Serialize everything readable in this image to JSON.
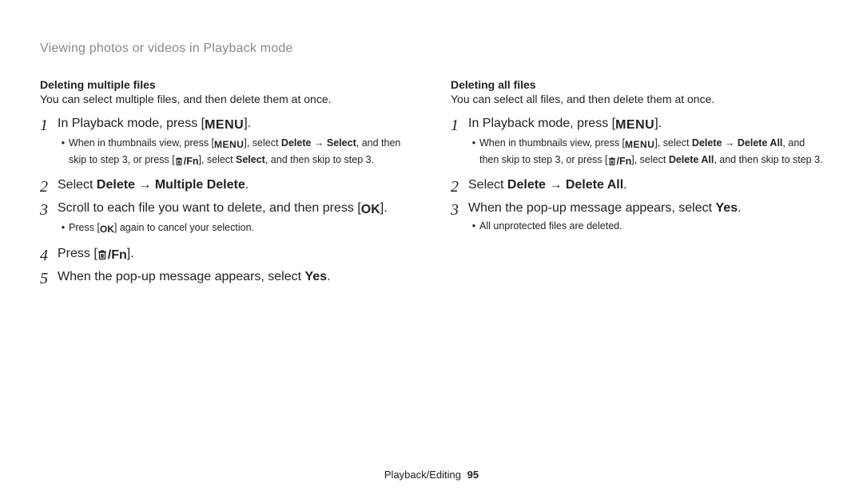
{
  "header": "Viewing photos or videos in Playback mode",
  "footer": {
    "section": "Playback/Editing",
    "page": "95"
  },
  "buttons": {
    "menu": "MENU",
    "ok": "OK",
    "fn": "Fn"
  },
  "left": {
    "title": "Deleting multiple files",
    "desc": "You can select multiple files, and then delete them at once.",
    "steps": {
      "s1": {
        "num": "1",
        "pre": "In Playback mode, press [",
        "post": "]."
      },
      "s1sub": {
        "p1": "When in thumbnails view, press [",
        "p2": "], select ",
        "b1": "Delete",
        "arrow1": " → ",
        "b2": "Select",
        "p3": ", and then skip to step 3, or press [",
        "p4": "], select ",
        "b3": "Select",
        "p5": ", and then skip to step 3."
      },
      "s2": {
        "num": "2",
        "pre": "Select ",
        "b1": "Delete",
        "arrow": " → ",
        "b2": "Multiple Delete",
        "post": "."
      },
      "s3": {
        "num": "3",
        "pre": "Scroll to each file you want to delete, and then press [",
        "post": "]."
      },
      "s3sub": {
        "p1": "Press [",
        "p2": "] again to cancel your selection."
      },
      "s4": {
        "num": "4",
        "pre": "Press [",
        "post": "]."
      },
      "s5": {
        "num": "5",
        "pre": "When the pop-up message appears, select ",
        "b1": "Yes",
        "post": "."
      }
    }
  },
  "right": {
    "title": "Deleting all files",
    "desc": "You can select all files, and then delete them at once.",
    "steps": {
      "s1": {
        "num": "1",
        "pre": "In Playback mode, press [",
        "post": "]."
      },
      "s1sub": {
        "p1": "When in thumbnails view, press [",
        "p2": "], select ",
        "b1": "Delete",
        "arrow1": " → ",
        "b2": "Delete All",
        "p3": ", and then skip to step 3, or press [",
        "p4": "], select ",
        "b3": "Delete All",
        "p5": ", and then skip to step 3."
      },
      "s2": {
        "num": "2",
        "pre": "Select ",
        "b1": "Delete",
        "arrow": " → ",
        "b2": "Delete All",
        "post": "."
      },
      "s3": {
        "num": "3",
        "pre": "When the pop-up message appears, select ",
        "b1": "Yes",
        "post": "."
      },
      "s3sub": {
        "text": "All unprotected files are deleted."
      }
    }
  }
}
